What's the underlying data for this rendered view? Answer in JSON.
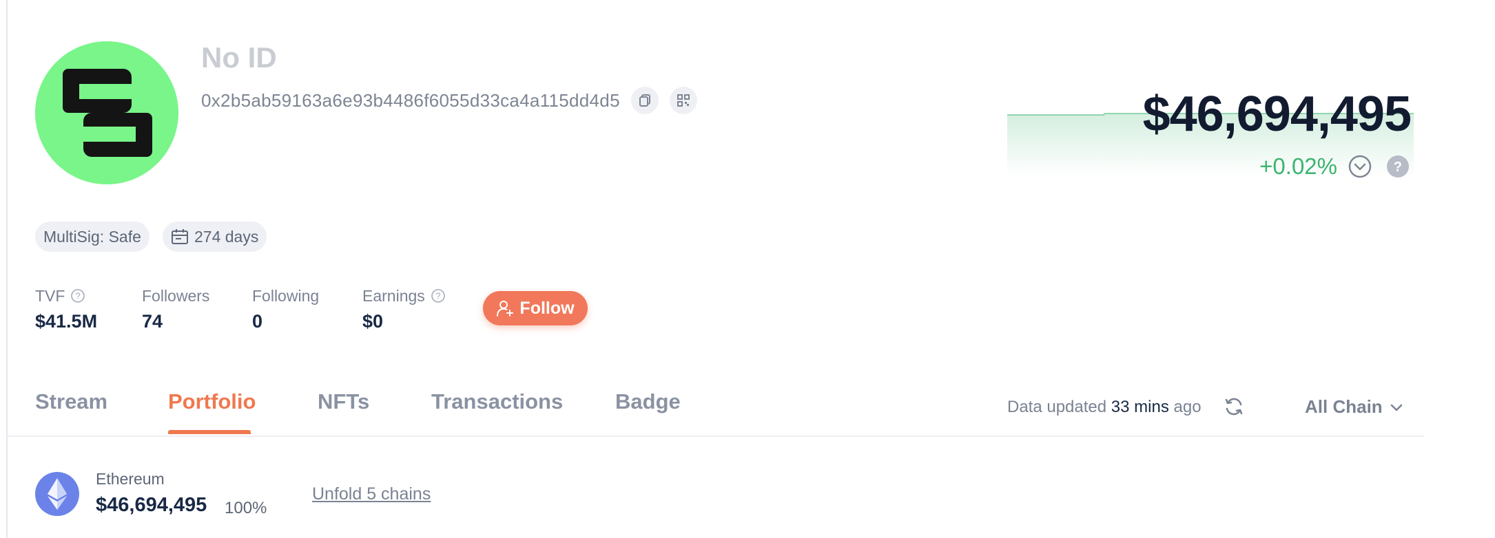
{
  "profile": {
    "id_label": "No ID",
    "address": "0x2b5ab59163a6e93b4486f6055d33ca4a115dd4d5",
    "avatar_icon": "logo-avatar-icon",
    "avatar_color": "#79f58a"
  },
  "balance": {
    "total": "$46,694,495",
    "change": "+0.02%",
    "change_color": "#3bb46f"
  },
  "tags": {
    "multisig": "MultiSig: Safe",
    "age": "274 days"
  },
  "stats": {
    "tvf_label": "TVF",
    "tvf_value": "$41.5M",
    "followers_label": "Followers",
    "followers_value": "74",
    "following_label": "Following",
    "following_value": "0",
    "earnings_label": "Earnings",
    "earnings_value": "$0"
  },
  "follow_button": {
    "label": "Follow",
    "color": "#f1785a"
  },
  "tabs": [
    {
      "label": "Stream"
    },
    {
      "label": "Portfolio",
      "active": true
    },
    {
      "label": "NFTs"
    },
    {
      "label": "Transactions"
    },
    {
      "label": "Badge"
    }
  ],
  "data_status": {
    "prefix": "Data updated",
    "time": "33 mins",
    "suffix": "ago"
  },
  "chain_filter": {
    "selected": "All Chain"
  },
  "chain_row": {
    "name": "Ethereum",
    "value": "$46,694,495",
    "percent": "100%",
    "unfold_link": "Unfold 5 chains"
  },
  "accent_color": "#f0784f"
}
